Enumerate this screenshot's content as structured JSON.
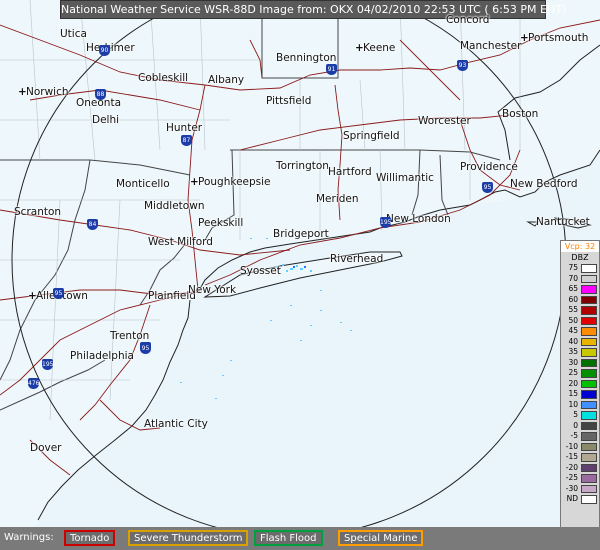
{
  "title": "National Weather Service WSR-88D Image from: OKX 04/02/2010 22:53 UTC ( 6:53 PM EDT)",
  "places": [
    {
      "name": "Utica",
      "mk": ""
    },
    {
      "name": "Herkimer",
      "mk": ""
    },
    {
      "name": "Norwich",
      "mk": "+"
    },
    {
      "name": "Oneonta",
      "mk": ""
    },
    {
      "name": "Delhi",
      "mk": ""
    },
    {
      "name": "Cobleskill",
      "mk": ""
    },
    {
      "name": "Albany",
      "mk": ""
    },
    {
      "name": "Hunter",
      "mk": ""
    },
    {
      "name": "Bennington",
      "mk": ""
    },
    {
      "name": "Keene",
      "mk": "+"
    },
    {
      "name": "Concord",
      "mk": ""
    },
    {
      "name": "Manchester",
      "mk": ""
    },
    {
      "name": "Portsmouth",
      "mk": "+"
    },
    {
      "name": "Pittsfield",
      "mk": ""
    },
    {
      "name": "Springfield",
      "mk": ""
    },
    {
      "name": "Worcester",
      "mk": ""
    },
    {
      "name": "Boston",
      "mk": ""
    },
    {
      "name": "Monticello",
      "mk": ""
    },
    {
      "name": "Poughkeepsie",
      "mk": "+"
    },
    {
      "name": "Torrington",
      "mk": ""
    },
    {
      "name": "Hartford",
      "mk": ""
    },
    {
      "name": "Willimantic",
      "mk": ""
    },
    {
      "name": "Providence",
      "mk": ""
    },
    {
      "name": "New Bedford",
      "mk": ""
    },
    {
      "name": "Scranton",
      "mk": ""
    },
    {
      "name": "Middletown",
      "mk": ""
    },
    {
      "name": "Meriden",
      "mk": ""
    },
    {
      "name": "New London",
      "mk": ""
    },
    {
      "name": "Nantucket",
      "mk": ""
    },
    {
      "name": "Peekskill",
      "mk": ""
    },
    {
      "name": "West Milford",
      "mk": ""
    },
    {
      "name": "Bridgeport",
      "mk": ""
    },
    {
      "name": "Riverhead",
      "mk": ""
    },
    {
      "name": "Syosset",
      "mk": ""
    },
    {
      "name": "Allentown",
      "mk": "+"
    },
    {
      "name": "Plainfield",
      "mk": ""
    },
    {
      "name": "New York",
      "mk": ""
    },
    {
      "name": "Trenton",
      "mk": ""
    },
    {
      "name": "Philadelphia",
      "mk": ""
    },
    {
      "name": "Atlantic City",
      "mk": ""
    },
    {
      "name": "Dover",
      "mk": ""
    }
  ],
  "legend": {
    "product": "Vcp: 32",
    "unit": "DBZ",
    "rows": [
      {
        "label": "75",
        "color": "#ffffff"
      },
      {
        "label": "70",
        "color": "#d0d0d0"
      },
      {
        "label": "65",
        "color": "#ff00ff"
      },
      {
        "label": "60",
        "color": "#800000"
      },
      {
        "label": "55",
        "color": "#b00000"
      },
      {
        "label": "50",
        "color": "#e00000"
      },
      {
        "label": "45",
        "color": "#ff8c00"
      },
      {
        "label": "40",
        "color": "#e8b400"
      },
      {
        "label": "35",
        "color": "#c8c800"
      },
      {
        "label": "30",
        "color": "#007000"
      },
      {
        "label": "25",
        "color": "#009000"
      },
      {
        "label": "20",
        "color": "#00c000"
      },
      {
        "label": "15",
        "color": "#0000d0"
      },
      {
        "label": "10",
        "color": "#4090ff"
      },
      {
        "label": "5",
        "color": "#00e0e0"
      },
      {
        "label": "0",
        "color": "#444444"
      },
      {
        "label": "-5",
        "color": "#666666"
      },
      {
        "label": "-10",
        "color": "#8a8a6a"
      },
      {
        "label": "-15",
        "color": "#b0a890"
      },
      {
        "label": "-20",
        "color": "#604070"
      },
      {
        "label": "-25",
        "color": "#9a6aa0"
      },
      {
        "label": "-30",
        "color": "#c8a8c8"
      },
      {
        "label": "ND",
        "color": "#ffffff"
      }
    ]
  },
  "warnings": {
    "label": "Warnings:",
    "items": [
      {
        "name": "Tornado",
        "color": "#cc0000"
      },
      {
        "name": "Severe Thunderstorm",
        "color": "#d8a000"
      },
      {
        "name": "Flash Flood",
        "color": "#00a040"
      },
      {
        "name": "Special Marine",
        "color": "#ff9c00"
      }
    ]
  },
  "highways": [
    {
      "num": "90"
    },
    {
      "num": "88"
    },
    {
      "num": "87"
    },
    {
      "num": "84"
    },
    {
      "num": "91"
    },
    {
      "num": "93"
    },
    {
      "num": "95"
    },
    {
      "num": "195"
    },
    {
      "num": "95"
    },
    {
      "num": "78"
    },
    {
      "num": "195"
    },
    {
      "num": "476"
    },
    {
      "num": "95"
    }
  ]
}
